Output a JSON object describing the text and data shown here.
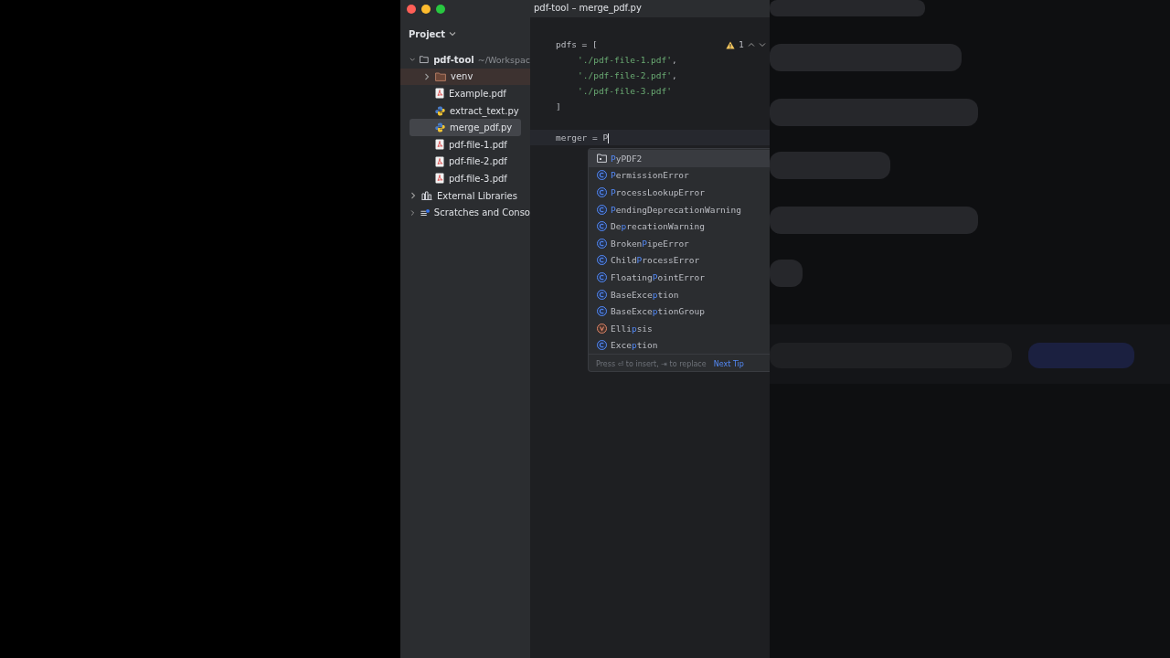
{
  "window": {
    "title": "pdf-tool – merge_pdf.py"
  },
  "sidebar": {
    "title": "Project",
    "tree": [
      {
        "name": "pdf-tool",
        "path": "~/Workspac",
        "kind": "project",
        "expanded": true,
        "selected": false,
        "children": [
          {
            "name": "venv",
            "kind": "excluded_folder",
            "expanded": false,
            "selected": false
          },
          {
            "name": "Example.pdf",
            "kind": "pdf",
            "selected": false
          },
          {
            "name": "extract_text.py",
            "kind": "python",
            "selected": false
          },
          {
            "name": "merge_pdf.py",
            "kind": "python",
            "selected": true
          },
          {
            "name": "pdf-file-1.pdf",
            "kind": "pdf",
            "selected": false
          },
          {
            "name": "pdf-file-2.pdf",
            "kind": "pdf",
            "selected": false
          },
          {
            "name": "pdf-file-3.pdf",
            "kind": "pdf",
            "selected": false
          }
        ]
      },
      {
        "name": "External Libraries",
        "kind": "libraries",
        "expanded": false,
        "selected": false
      },
      {
        "name": "Scratches and Conso",
        "kind": "scratches",
        "expanded": false,
        "selected": false
      }
    ]
  },
  "editor": {
    "warnings": "1",
    "lines": [
      {
        "current": false,
        "tokens": [
          {
            "kind": "plain",
            "text": "pdfs = ["
          }
        ]
      },
      {
        "current": false,
        "indented": true,
        "tokens": [
          {
            "kind": "string",
            "text": "'./pdf-file-1.pdf'"
          },
          {
            "kind": "plain",
            "text": ","
          }
        ]
      },
      {
        "current": false,
        "indented": true,
        "tokens": [
          {
            "kind": "string",
            "text": "'./pdf-file-2.pdf'"
          },
          {
            "kind": "plain",
            "text": ","
          }
        ]
      },
      {
        "current": false,
        "indented": true,
        "tokens": [
          {
            "kind": "string",
            "text": "'./pdf-file-3.pdf'"
          }
        ]
      },
      {
        "current": false,
        "tokens": [
          {
            "kind": "plain",
            "text": "]"
          }
        ]
      },
      {
        "current": false
      },
      {
        "current": true,
        "tokens": [
          {
            "kind": "plain",
            "text": "merger = P"
          }
        ]
      }
    ]
  },
  "completion": {
    "items": [
      {
        "kind": "module",
        "match": "P",
        "after": "yPDF2",
        "selected": true
      },
      {
        "kind": "class",
        "match": "P",
        "after": "ermissionError",
        "selected": false
      },
      {
        "kind": "class",
        "match": "P",
        "after": "rocessLookupError",
        "selected": false
      },
      {
        "kind": "class",
        "match": "P",
        "after": "endingDeprecationWarning",
        "selected": false
      },
      {
        "kind": "class",
        "before": "De",
        "match": "p",
        "after": "recationWarning",
        "selected": false
      },
      {
        "kind": "class",
        "before": "Broken",
        "match": "P",
        "after": "ipeError",
        "selected": false
      },
      {
        "kind": "class",
        "before": "Child",
        "match": "P",
        "after": "rocessError",
        "selected": false
      },
      {
        "kind": "class",
        "before": "Floating",
        "match": "P",
        "after": "ointError",
        "selected": false
      },
      {
        "kind": "class",
        "before": "BaseExce",
        "match": "p",
        "after": "tion",
        "selected": false
      },
      {
        "kind": "class",
        "before": "BaseExce",
        "match": "p",
        "after": "tionGroup",
        "selected": false
      },
      {
        "kind": "variable",
        "before": "Elli",
        "match": "p",
        "after": "sis",
        "selected": false
      },
      {
        "kind": "class",
        "before": "Exce",
        "match": "p",
        "after": "tion",
        "selected": false
      }
    ],
    "hint": "Press ⏎ to insert, ⇥ to replace",
    "tip_link": "Next Tip"
  }
}
